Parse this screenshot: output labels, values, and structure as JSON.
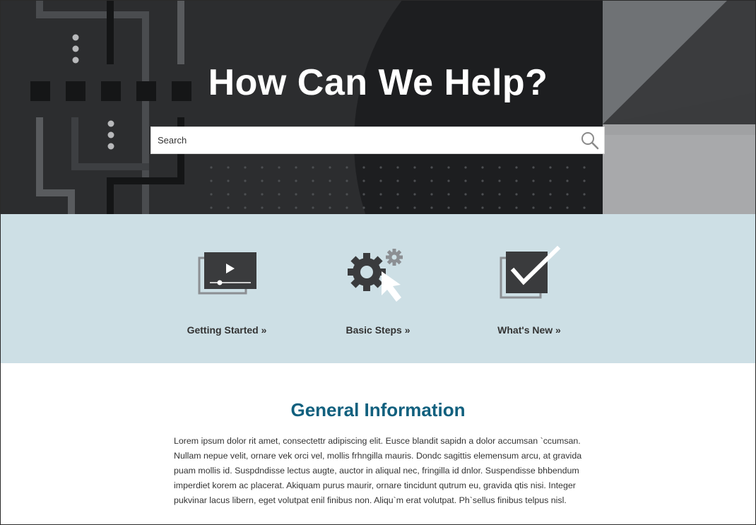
{
  "hero": {
    "title": "How Can We Help?",
    "search_placeholder": "Search",
    "search_icon": "search-icon"
  },
  "quick_links": [
    {
      "label": "Getting Started »",
      "icon": "video-icon"
    },
    {
      "label": "Basic Steps »",
      "icon": "gear-cursor-icon"
    },
    {
      "label": "What's New »",
      "icon": "checkmark-icon"
    }
  ],
  "info": {
    "title": "General Information",
    "body": "Lorem ipsum dolor rit amet, consectettr adipiscing elit. Eusce blandit sapidn a dolor accumsan `ccumsan. Nullam nepue velit, ornare vek orci vel, mollis frhngilla mauris. Dondc sagittis elemensum arcu, at gravida puam mollis id. Suspdndisse lectus augte, auctor in aliqual nec, fringilla id dnlor. Suspendisse bhbendum imperdiet korem ac placerat. Akiquam purus maurir, ornare tincidunt qutrum eu, gravida qtis nisi. Integer pukvinar lacus libern, eget volutpat enil finibus non. Aliqu`m erat volutpat. Ph`sellus finibus telpus nisl."
  },
  "colors": {
    "hero_bg": "#2c2d2f",
    "quick_bg": "#cddfe5",
    "title_accent": "#11607e",
    "text": "#333333"
  }
}
